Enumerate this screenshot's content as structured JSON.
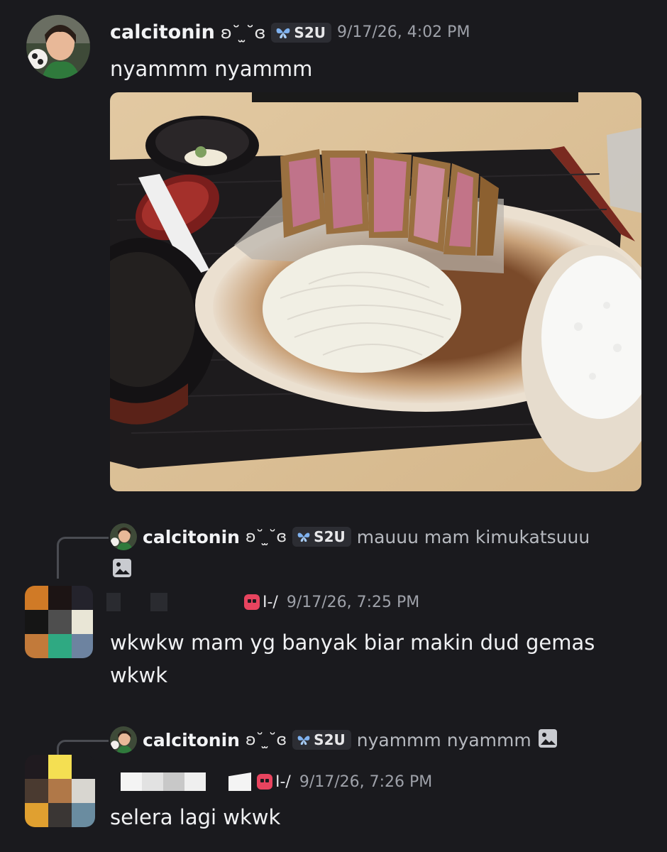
{
  "messages": [
    {
      "username": "calcitonin",
      "name_deco": "ʚ˘ ̫˘ɞ",
      "tag_icon": "butterfly-icon",
      "tag": "S2U",
      "timestamp": "9/17/26, 4:02 PM",
      "text": "nyammm nyammm",
      "attachment": "food-photo"
    },
    {
      "reply_to": {
        "username": "calcitonin",
        "name_deco": "ʚ˘ ̫˘ɞ",
        "tag": "S2U",
        "preview": "mauuu mam kimukatsuuu",
        "preview_icon": "image-icon"
      },
      "role_icon": "skull-icon",
      "role_tag": "I-/",
      "timestamp": "9/17/26, 7:25 PM",
      "text_line1": "wkwkw mam yg banyak biar makin dud gemas",
      "text_line2": "wkwk"
    },
    {
      "reply_to": {
        "username": "calcitonin",
        "name_deco": "ʚ˘ ̫˘ɞ",
        "tag": "S2U",
        "preview": "nyammm nyammm",
        "preview_icon": "image-icon"
      },
      "role_icon": "skull-icon",
      "role_tag": "I-/",
      "timestamp": "9/17/26, 7:26 PM",
      "text": "selera lagi wkwk"
    }
  ],
  "colors": {
    "background": "#1a1a1e",
    "tag_bg": "#2c2d33",
    "muted": "#9ea1a9",
    "role_red": "#e8445f"
  }
}
